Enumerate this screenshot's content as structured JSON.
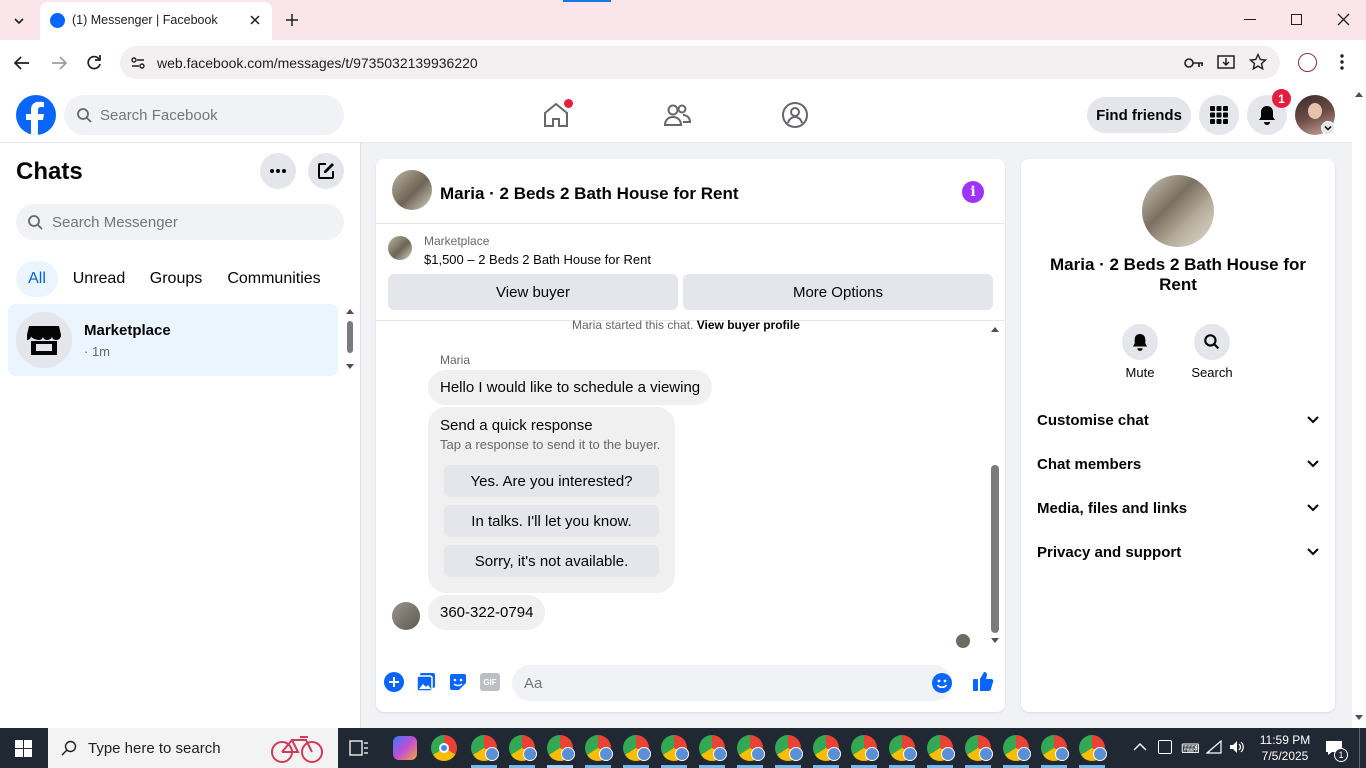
{
  "browser": {
    "tab_title": "(1) Messenger | Facebook",
    "url": "web.facebook.com/messages/t/9735032139936220"
  },
  "header": {
    "search_placeholder": "Search Facebook",
    "find_friends": "Find friends",
    "notification_count": "1"
  },
  "sidebar": {
    "title": "Chats",
    "search_placeholder": "Search Messenger",
    "filters": [
      "All",
      "Unread",
      "Groups",
      "Communities"
    ],
    "active_filter": "All",
    "chats": [
      {
        "name": "Marketplace",
        "meta": "· 1m"
      }
    ]
  },
  "conversation": {
    "title": "Maria · 2 Beds 2 Bath House for Rent",
    "marketplace_label": "Marketplace",
    "listing": "$1,500 – 2 Beds 2 Bath House for Rent",
    "view_buyer": "View buyer",
    "more_options": "More Options",
    "started_text": "Maria started this chat.",
    "view_buyer_profile": "View buyer profile",
    "sender_name": "Maria",
    "message_1": "Hello I would like to schedule a viewing",
    "quick_response_title": "Send a quick response",
    "quick_response_sub": "Tap a response to send it to the buyer.",
    "quick_responses": [
      "Yes. Are you interested?",
      "In talks. I'll let you know.",
      "Sorry, it's not available."
    ],
    "message_2": "360-322-0794",
    "composer_placeholder": "Aa"
  },
  "details": {
    "title": "Maria · 2 Beds 2 Bath House for Rent",
    "mute": "Mute",
    "search": "Search",
    "sections": [
      "Customise chat",
      "Chat members",
      "Media, files and links",
      "Privacy and support"
    ]
  },
  "taskbar": {
    "search_placeholder": "Type here to search",
    "time": "11:59 PM",
    "date": "7/5/2025",
    "notif_count": "1"
  },
  "colors": {
    "fb_blue": "#0866ff",
    "messenger_purple": "#a033ff",
    "active_chat_bg": "#ebf5ff"
  }
}
